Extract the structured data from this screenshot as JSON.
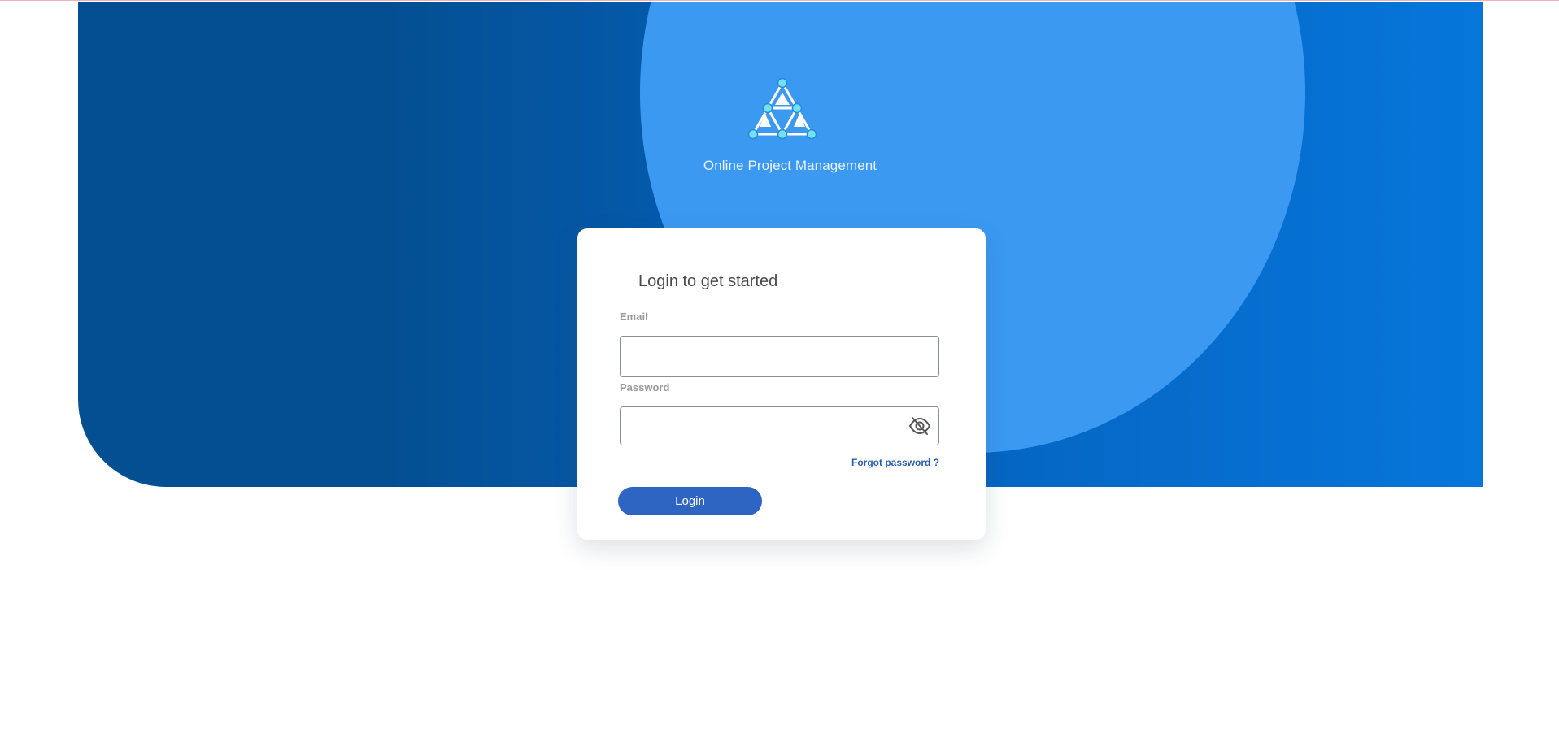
{
  "app": {
    "title": "Online Project Management",
    "logo_icon": "network-triangle-logo"
  },
  "login": {
    "heading": "Login to get started",
    "email_label": "Email",
    "email_value": "",
    "password_label": "Password",
    "password_value": "",
    "password_toggle_icon": "eye-slash-icon",
    "forgot_link": "Forgot password ?",
    "submit_label": "Login"
  },
  "colors": {
    "hero_dark": "#044f92",
    "hero_light": "#0676db",
    "circle": "#3b99f2",
    "button": "#2f65c2",
    "link": "#2a5db4"
  }
}
